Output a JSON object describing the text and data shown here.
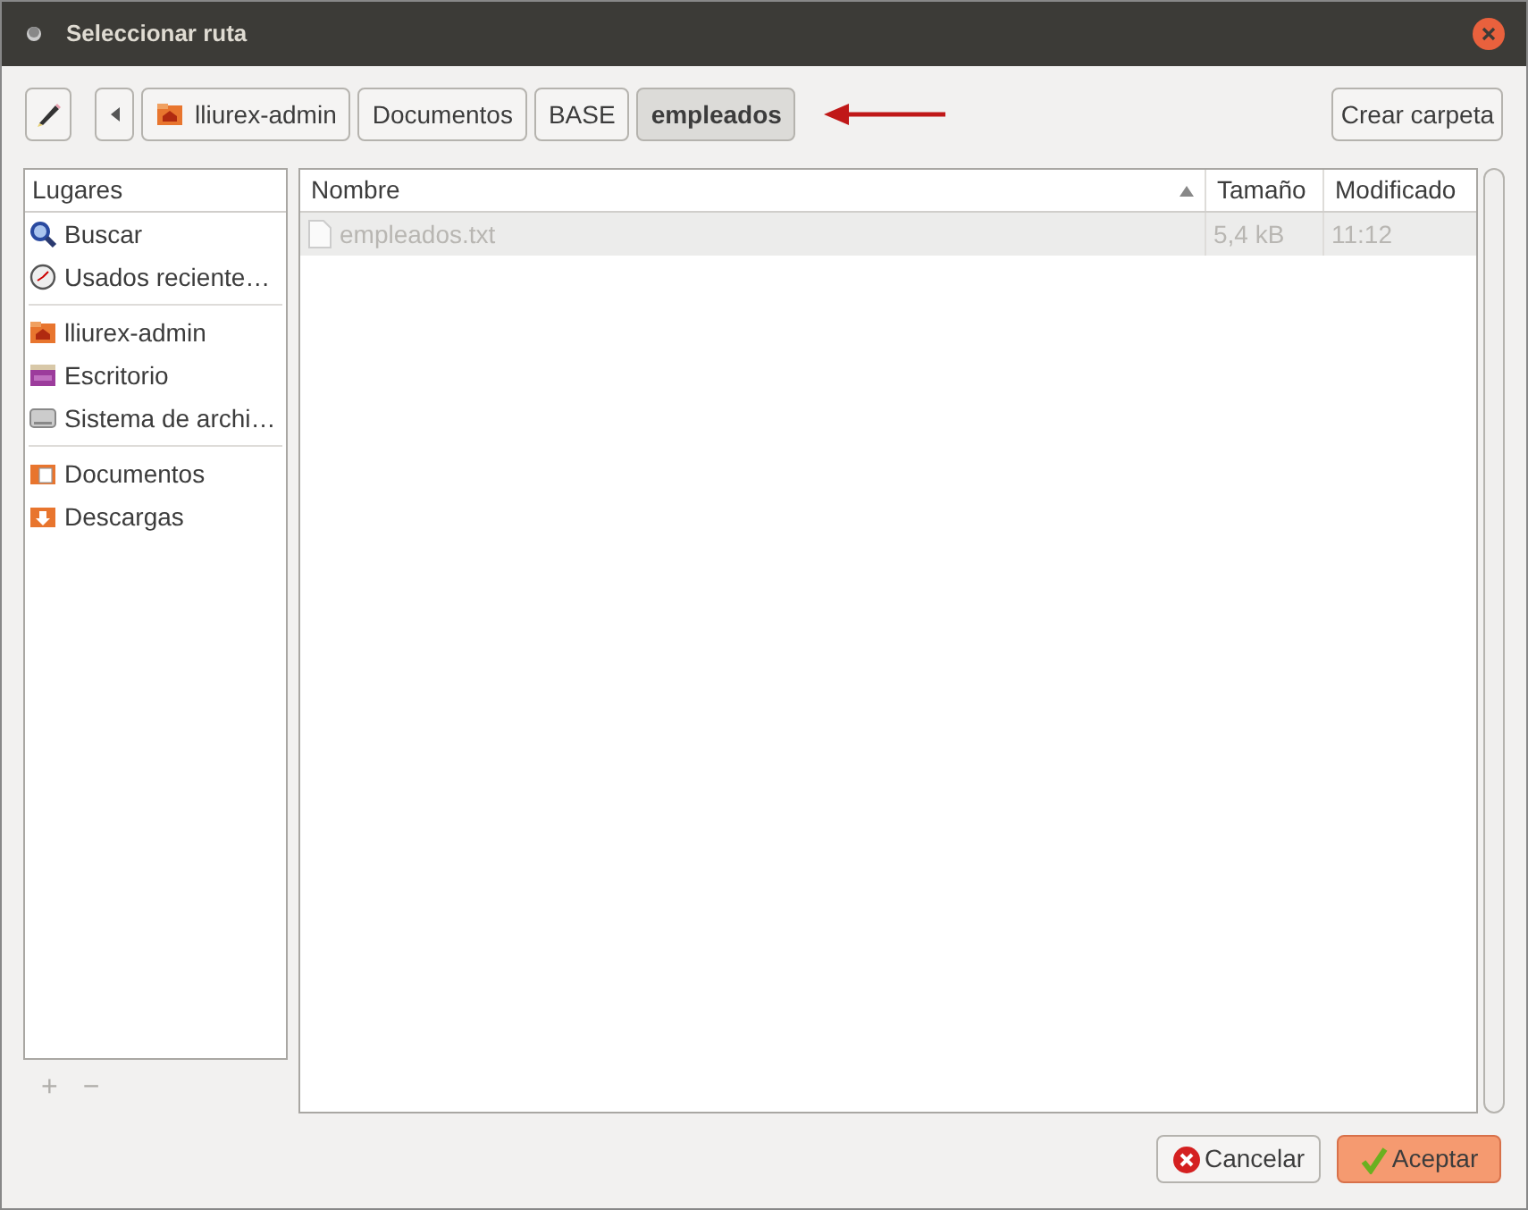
{
  "window": {
    "title": "Seleccionar ruta"
  },
  "path_bar": {
    "crumbs": [
      {
        "label": "lliurex-admin",
        "kind": "home",
        "selected": false
      },
      {
        "label": "Documentos",
        "selected": false
      },
      {
        "label": "BASE",
        "selected": false
      },
      {
        "label": "empleados",
        "selected": true
      }
    ]
  },
  "create_folder_button": "Crear carpeta",
  "places": {
    "header": "Lugares",
    "sections": [
      {
        "items": [
          {
            "label": "Buscar",
            "kind": "search"
          },
          {
            "label": "Usados reciente…",
            "kind": "recent"
          }
        ]
      },
      {
        "items": [
          {
            "label": "lliurex-admin",
            "kind": "home"
          },
          {
            "label": "Escritorio",
            "kind": "desktop"
          },
          {
            "label": "Sistema de archi…",
            "kind": "drive"
          }
        ]
      },
      {
        "items": [
          {
            "label": "Documentos",
            "kind": "documents"
          },
          {
            "label": "Descargas",
            "kind": "downloads"
          }
        ]
      }
    ],
    "add": "+",
    "remove": "−"
  },
  "files": {
    "columns": [
      "Nombre",
      "Tamaño",
      "Modificado"
    ],
    "rows": [
      {
        "name": "empleados.txt",
        "size": "5,4 kB",
        "modified": "11:12",
        "disabled": true
      }
    ]
  },
  "buttons": [
    {
      "label": "Cancelar",
      "kind": "cancel"
    },
    {
      "label": "Aceptar",
      "kind": "accept"
    }
  ]
}
